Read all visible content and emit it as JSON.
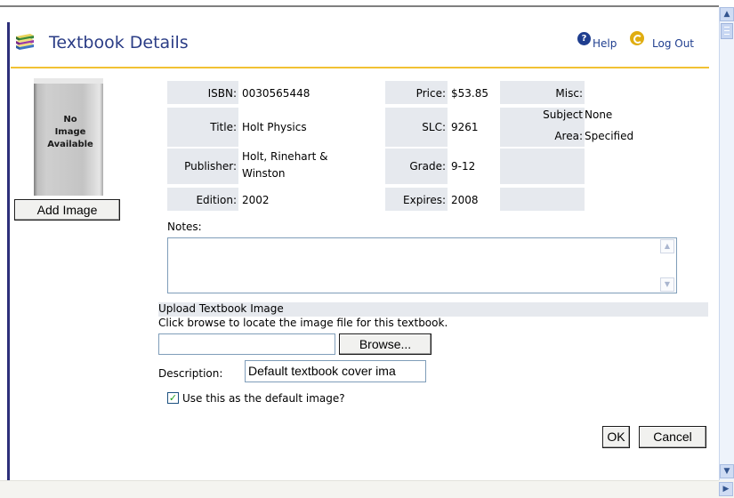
{
  "header": {
    "title": "Textbook Details",
    "help_label": "Help",
    "logout_label": "Log Out"
  },
  "image_panel": {
    "placeholder_text": "No\nImage\nAvailable",
    "add_image_label": "Add Image"
  },
  "details": {
    "isbn_label": "ISBN:",
    "isbn": "0030565448",
    "title_label": "Title:",
    "title": "Holt Physics",
    "publisher_label": "Publisher:",
    "publisher_line1": "Holt, Rinehart &",
    "publisher_line2": "Winston",
    "edition_label": "Edition:",
    "edition": "2002",
    "price_label": "Price:",
    "price": "$53.85",
    "slc_label": "SLC:",
    "slc": "9261",
    "grade_label": "Grade:",
    "grade": "9-12",
    "expires_label": "Expires:",
    "expires": "2008",
    "misc_label": "Misc:",
    "misc": "",
    "subject_area_label_1": "Subject",
    "subject_area_label_2": "Area:",
    "subject_area_value_1": "None",
    "subject_area_value_2": "Specified"
  },
  "notes": {
    "label": "Notes:",
    "value": ""
  },
  "upload": {
    "section_title": "Upload Textbook Image",
    "hint": "Click browse to locate the image file for this textbook.",
    "file_value": "",
    "browse_label": "Browse...",
    "description_label": "Description:",
    "description_value": "Default textbook cover ima",
    "default_checkbox_checked": true,
    "default_checkbox_label": "Use this as the default image?"
  },
  "actions": {
    "ok_label": "OK",
    "cancel_label": "Cancel"
  },
  "colors": {
    "title": "#2b3d86",
    "gold_rule": "#f2c233",
    "cell_bg": "#e6e9ee",
    "left_bar": "#2d2f7a"
  }
}
